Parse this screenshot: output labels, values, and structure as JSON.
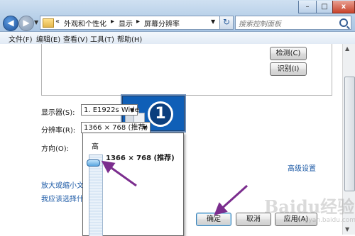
{
  "window": {
    "minimize_label": "–",
    "maximize_label": "□",
    "close_label": "x"
  },
  "nav": {
    "back_glyph": "◀",
    "forward_glyph": "▶",
    "dropdown_glyph": "▼"
  },
  "address": {
    "overflow": "«",
    "crumbs": [
      "外观和个性化",
      "显示",
      "屏幕分辨率"
    ],
    "separator": "▸",
    "dropdown_glyph": "▼",
    "refresh_glyph": "↻"
  },
  "search": {
    "placeholder": "搜索控制面板"
  },
  "menu": [
    "文件(F)",
    "编辑(E)",
    "查看(V)",
    "工具(T)",
    "帮助(H)"
  ],
  "monitor": {
    "number": "1"
  },
  "buttons": {
    "detect": "检测(C)",
    "identify": "识别(I)",
    "ok": "确定",
    "cancel": "取消",
    "apply": "应用(A)"
  },
  "settings": {
    "display_label": "显示器(S):",
    "display_value": "1. E1922s Wide",
    "resolution_label": "分辨率(R):",
    "resolution_value": "1366 × 768 (推荐)",
    "orientation_label": "方向(O):",
    "advanced_link": "高级设置",
    "link_text_size": "放大或缩小文本",
    "link_help_choose": "我应该选择什么"
  },
  "resolution_popup": {
    "high_label": "高",
    "selected_value": "1366 × 768 (推荐)",
    "slider_level": 1.0
  },
  "watermark": {
    "text": "Baidu经验",
    "sub": "jingyan.baidu.com"
  },
  "colors": {
    "annotation_arrow": "#7b2d8e",
    "link": "#1c5aa6",
    "monitor": "#0f5fb7"
  },
  "icons": [
    "back-arrow-icon",
    "forward-arrow-icon",
    "folder-icon",
    "refresh-icon",
    "search-icon",
    "monitor-icon"
  ]
}
